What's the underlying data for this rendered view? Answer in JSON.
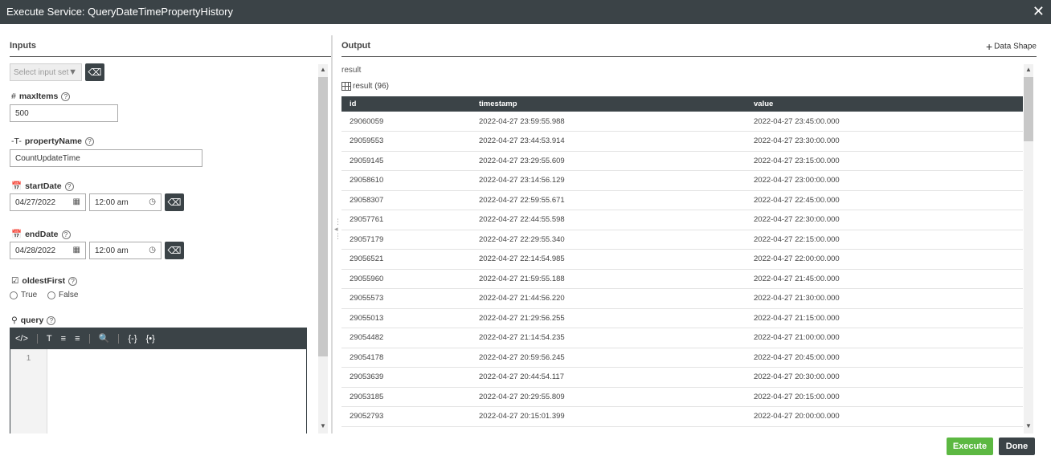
{
  "window": {
    "title": "Execute Service: QueryDateTimePropertyHistory",
    "close_glyph": "✕"
  },
  "inputs": {
    "heading": "Inputs",
    "select_input_set": {
      "placeholder": "Select input set"
    },
    "params": {
      "maxItems": {
        "type_glyph": "#",
        "name": "maxItems",
        "value": "500"
      },
      "propertyName": {
        "type_glyph": "-T-",
        "name": "propertyName",
        "value": "CountUpdateTime"
      },
      "startDate": {
        "type_glyph": "📅",
        "name": "startDate",
        "date": "04/27/2022",
        "time": "12:00 am"
      },
      "endDate": {
        "type_glyph": "📅",
        "name": "endDate",
        "date": "04/28/2022",
        "time": "12:00 am"
      },
      "oldestFirst": {
        "type_glyph": "☑",
        "name": "oldestFirst",
        "option_true": "True",
        "option_false": "False"
      },
      "query": {
        "type_glyph": "⚲",
        "name": "query",
        "line_number": "1"
      }
    },
    "help_glyph": "?",
    "editor_toolbar": [
      "</>",
      "T",
      "≡",
      "≡",
      "🔍",
      "{-}",
      "{•}"
    ]
  },
  "output": {
    "heading": "Output",
    "data_shape_label": "Data Shape",
    "result_label": "result",
    "result_count_label": "result (96)",
    "columns": [
      "id",
      "timestamp",
      "value"
    ],
    "rows": [
      [
        "29060059",
        "2022-04-27 23:59:55.988",
        "2022-04-27 23:45:00.000"
      ],
      [
        "29059553",
        "2022-04-27 23:44:53.914",
        "2022-04-27 23:30:00.000"
      ],
      [
        "29059145",
        "2022-04-27 23:29:55.609",
        "2022-04-27 23:15:00.000"
      ],
      [
        "29058610",
        "2022-04-27 23:14:56.129",
        "2022-04-27 23:00:00.000"
      ],
      [
        "29058307",
        "2022-04-27 22:59:55.671",
        "2022-04-27 22:45:00.000"
      ],
      [
        "29057761",
        "2022-04-27 22:44:55.598",
        "2022-04-27 22:30:00.000"
      ],
      [
        "29057179",
        "2022-04-27 22:29:55.340",
        "2022-04-27 22:15:00.000"
      ],
      [
        "29056521",
        "2022-04-27 22:14:54.985",
        "2022-04-27 22:00:00.000"
      ],
      [
        "29055960",
        "2022-04-27 21:59:55.188",
        "2022-04-27 21:45:00.000"
      ],
      [
        "29055573",
        "2022-04-27 21:44:56.220",
        "2022-04-27 21:30:00.000"
      ],
      [
        "29055013",
        "2022-04-27 21:29:56.255",
        "2022-04-27 21:15:00.000"
      ],
      [
        "29054482",
        "2022-04-27 21:14:54.235",
        "2022-04-27 21:00:00.000"
      ],
      [
        "29054178",
        "2022-04-27 20:59:56.245",
        "2022-04-27 20:45:00.000"
      ],
      [
        "29053639",
        "2022-04-27 20:44:54.117",
        "2022-04-27 20:30:00.000"
      ],
      [
        "29053185",
        "2022-04-27 20:29:55.809",
        "2022-04-27 20:15:00.000"
      ],
      [
        "29052793",
        "2022-04-27 20:15:01.399",
        "2022-04-27 20:00:00.000"
      ]
    ]
  },
  "footer": {
    "execute_label": "Execute",
    "done_label": "Done"
  },
  "colors": {
    "titlebar": "#3b4347",
    "execute": "#5cb842",
    "done": "#3b4347"
  }
}
